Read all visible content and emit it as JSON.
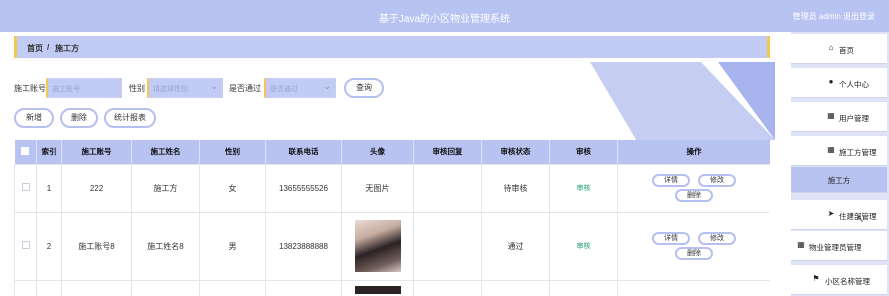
{
  "header": {
    "title": "基于Java的小区物业管理系统",
    "user_text": "管理员 admin  退出登录"
  },
  "breadcrumb": {
    "home": "首页",
    "sep": "/",
    "current": "施工方"
  },
  "search": {
    "account_label": "施工账号",
    "account_placeholder": "施工账号",
    "gender_label": "性别",
    "gender_placeholder": "请选择性别",
    "passed_label": "是否通过",
    "passed_placeholder": "是否通过",
    "query_button": "查询"
  },
  "actions": {
    "add": "新增",
    "delete": "删除",
    "report": "统计报表"
  },
  "table": {
    "headers": [
      "",
      "索引",
      "施工账号",
      "施工姓名",
      "性别",
      "联系电话",
      "头像",
      "审核回复",
      "审核状态",
      "审核",
      "操作"
    ],
    "rows": [
      {
        "index": "1",
        "account": "222",
        "name": "施工方",
        "gender": "女",
        "phone": "13655555526",
        "avatar": "无图片",
        "reply": "",
        "status": "待审核",
        "audit": "审核"
      },
      {
        "index": "2",
        "account": "施工账号8",
        "name": "施工姓名8",
        "gender": "男",
        "phone": "13823888888",
        "avatar": "",
        "reply": "",
        "status": "通过",
        "audit": "审核"
      }
    ],
    "row_buttons": {
      "detail": "详情",
      "edit": "修改",
      "delete": "删除"
    }
  },
  "sidebar": {
    "items": [
      {
        "label": "首页",
        "icon": "home-icon",
        "glyph": "⌂"
      },
      {
        "label": "个人中心",
        "icon": "user-icon",
        "glyph": "●"
      },
      {
        "label": "用户管理",
        "icon": "grid-icon",
        "glyph": "▦"
      },
      {
        "label": "施工方管理",
        "icon": "grid-icon",
        "glyph": "▦"
      },
      {
        "label": "施工方",
        "icon": "",
        "glyph": ""
      },
      {
        "label": "住建部管理",
        "icon": "send-icon",
        "glyph": "➤"
      },
      {
        "label": "物业管理员管理",
        "icon": "grid-icon",
        "glyph": "▦"
      },
      {
        "label": "小区名称管理",
        "icon": "flag-icon",
        "glyph": "⚑"
      }
    ]
  },
  "colors": {
    "primary": "#b9c3f2",
    "accent": "#f2c94c",
    "success": "#1aa26f"
  }
}
